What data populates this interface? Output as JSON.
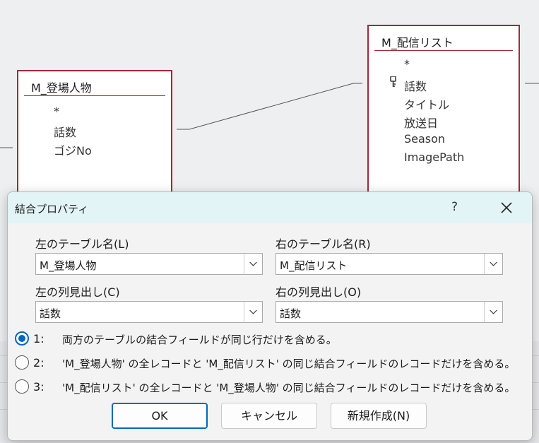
{
  "relationship_view": {
    "table_left": {
      "title": "M_登場人物",
      "fields": [
        "*",
        "話数",
        "ゴジNo"
      ]
    },
    "table_right": {
      "title": "M_配信リスト",
      "fields": [
        "*",
        "話数",
        "タイトル",
        "放送日",
        "Season",
        "ImagePath"
      ],
      "key_field_index": 1
    }
  },
  "dialog": {
    "title": "結合プロパティ",
    "help_label": "?",
    "left_table_label": "左のテーブル名(L)",
    "left_table_value": "M_登場人物",
    "right_table_label": "右のテーブル名(R)",
    "right_table_value": "M_配信リスト",
    "left_column_label": "左の列見出し(C)",
    "left_column_value": "話数",
    "right_column_label": "右の列見出し(O)",
    "right_column_value": "話数",
    "options": [
      {
        "number": "1:",
        "text": "両方のテーブルの結合フィールドが同じ行だけを含める。",
        "checked": true
      },
      {
        "number": "2:",
        "text": "'M_登場人物' の全レコードと 'M_配信リスト' の同じ結合フィールドのレコードだけを含める。",
        "checked": false
      },
      {
        "number": "3:",
        "text": "'M_配信リスト' の全レコードと 'M_登場人物' の同じ結合フィールドのレコードだけを含める。",
        "checked": false
      }
    ],
    "ok_label": "OK",
    "cancel_label": "キャンセル",
    "new_label": "新規作成(N)"
  },
  "colors": {
    "table_border": "#a4283a",
    "accent": "#0067c0",
    "titlebar": "#e3f4f6"
  }
}
